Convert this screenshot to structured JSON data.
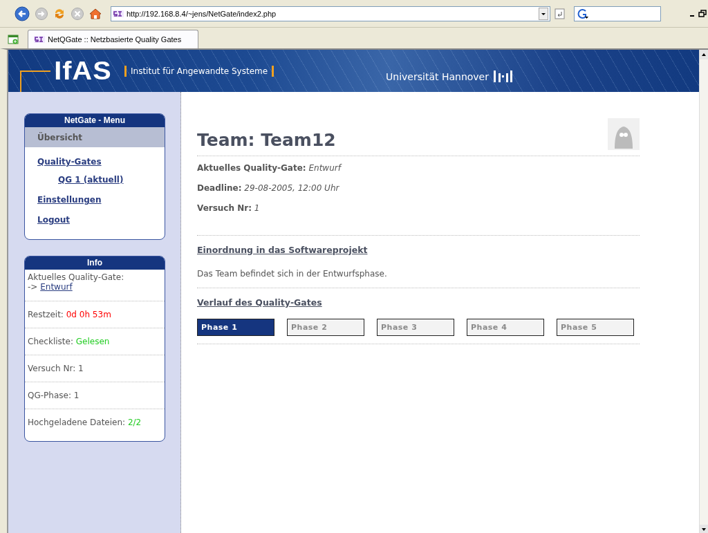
{
  "browser": {
    "address": "http://192.168.8.4/~jens/NetGate/index2.php",
    "tab_title": "NetQGate :: Netzbasierte Quality Gates"
  },
  "banner": {
    "logo": "IfAS",
    "institute": "Institut für Angewandte Systeme",
    "university": "Universität Hannover"
  },
  "menu": {
    "title": "NetGate - Menu",
    "items": [
      {
        "label": "Übersicht",
        "selected": true
      },
      {
        "label": "Quality-Gates",
        "selected": false,
        "children": [
          {
            "label": "QG 1 (aktuell)",
            "selected": false
          }
        ]
      },
      {
        "label": "Einstellungen",
        "selected": false
      },
      {
        "label": "Logout",
        "selected": false
      }
    ]
  },
  "info": {
    "title": "Info",
    "rows": [
      {
        "kind": "link",
        "label": "Aktuelles Quality-Gate:",
        "prefix": "->",
        "link": "Entwurf"
      },
      {
        "kind": "value",
        "label": "Restzeit:",
        "value": "0d 0h 53m",
        "color": "#ff0000"
      },
      {
        "kind": "value",
        "label": "Checkliste:",
        "value": "Gelesen",
        "color": "#22cc22"
      },
      {
        "kind": "plain",
        "label": "Versuch Nr: 1"
      },
      {
        "kind": "plain",
        "label": "QG-Phase: 1"
      },
      {
        "kind": "value",
        "label": "Hochgeladene Dateien:",
        "value": "2/2",
        "color": "#22cc22"
      }
    ]
  },
  "main": {
    "heading": "Team: Team12",
    "facts": [
      "**Aktuelles Quality-Gate:** *Entwurf*",
      "**Deadline:** *29-08-2005, 12:00 Uhr*",
      "**Versuch Nr:** *1*"
    ],
    "sections": [
      {
        "kind": "text",
        "title": "Einordnung in das Softwareprojekt",
        "text": "Das Team befindet sich in der Entwurfsphase."
      },
      {
        "kind": "phases",
        "title": "Verlauf des Quality-Gates",
        "phases": [
          {
            "label": "Phase 1",
            "selected": true
          },
          {
            "label": "Phase 2",
            "selected": false
          },
          {
            "label": "Phase 3",
            "selected": false
          },
          {
            "label": "Phase 4",
            "selected": false
          },
          {
            "label": "Phase 5",
            "selected": false
          }
        ]
      }
    ]
  }
}
